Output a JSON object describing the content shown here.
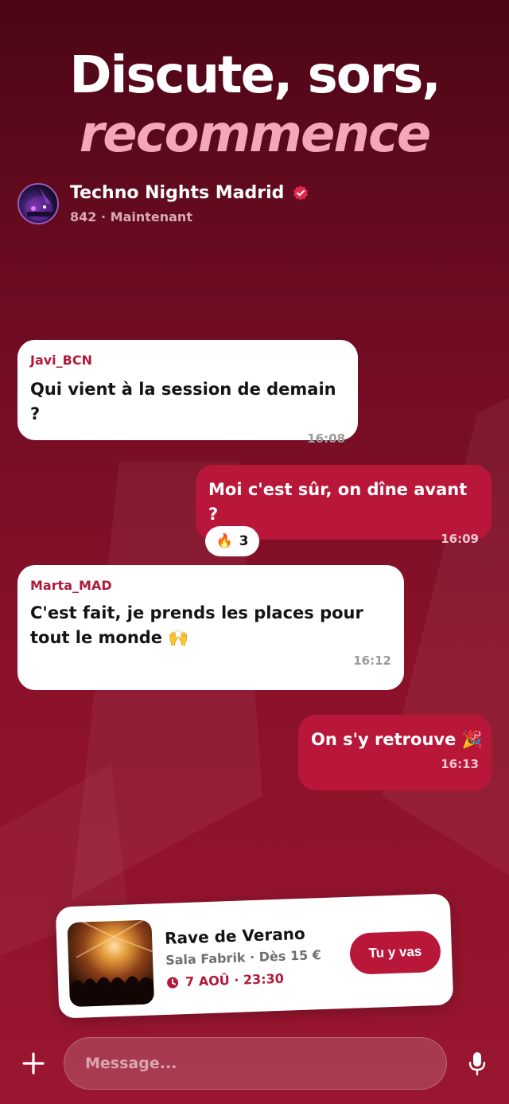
{
  "hero": {
    "line1": "Discute, sors,",
    "line2": "recommence"
  },
  "group": {
    "name": "Techno Nights Madrid",
    "members": "842",
    "separator": "·",
    "status": "Maintenant",
    "avatar_icon": "concert-avatar",
    "verified_icon": "verified-badge-icon"
  },
  "messages": [
    {
      "direction": "in",
      "sender": "Javi_BCN",
      "text": "Qui vient à la session de demain ?",
      "time": "16:08"
    },
    {
      "direction": "out",
      "text": "Moi c'est sûr, on dîne avant ?",
      "time": "16:09"
    },
    {
      "direction": "in",
      "sender": "Marta_MAD",
      "text_line1": "C'est fait, je prends les places pour",
      "text_line2": "tout le monde 🙌",
      "time": "16:12"
    },
    {
      "direction": "out",
      "text": "On s'y retrouve 🎉",
      "time": "16:13"
    }
  ],
  "reaction": {
    "emoji": "🔥",
    "count": "3"
  },
  "event": {
    "title": "Rave de Verano",
    "venue": "Sala Fabrik · Dès 15 €",
    "date": "7 AOÛ · 23:30",
    "cta": "Tu y vas",
    "clock_icon": "clock-icon"
  },
  "composer": {
    "placeholder": "Message...",
    "plus_icon": "plus-icon",
    "mic_icon": "microphone-icon"
  },
  "colors": {
    "accent": "#b8173a",
    "hero_highlight": "#f4a7b9",
    "background_top": "#4c0616",
    "background_bottom": "#9a1630"
  }
}
